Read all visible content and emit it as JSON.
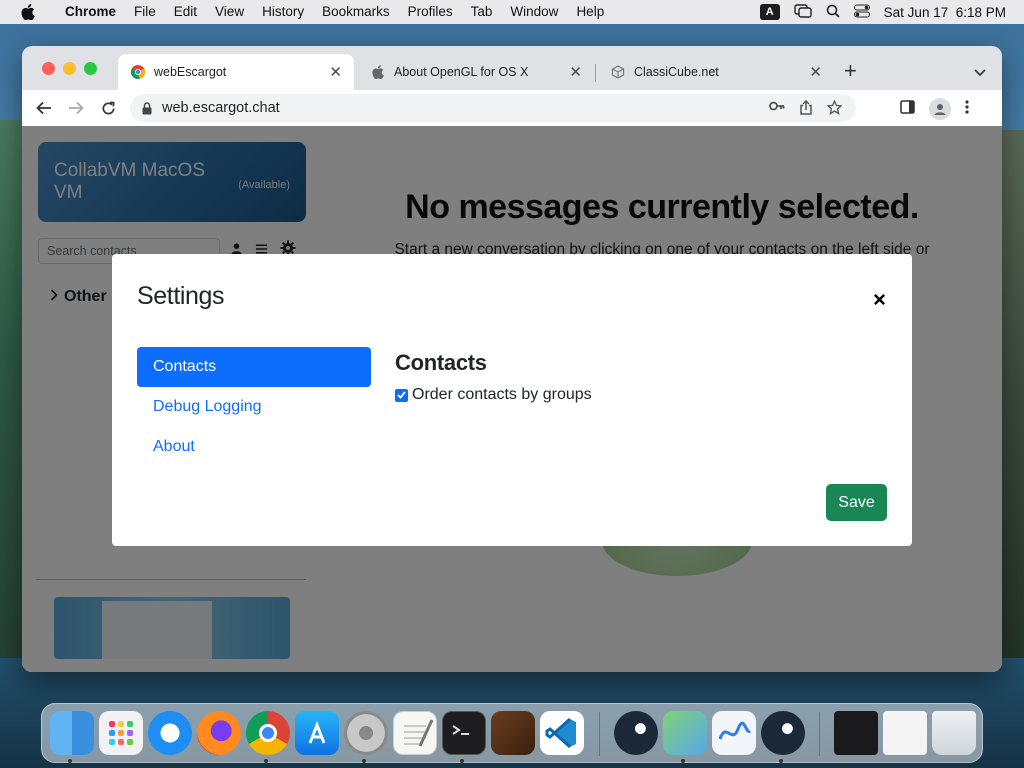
{
  "menubar": {
    "items": [
      "Chrome",
      "File",
      "Edit",
      "View",
      "History",
      "Bookmarks",
      "Profiles",
      "Tab",
      "Window",
      "Help"
    ],
    "input_source": "A",
    "datetime": "Sat Jun 17  6:18 PM"
  },
  "tabs": [
    {
      "title": "webEscargot",
      "active": true,
      "icon": "chrome-favicon"
    },
    {
      "title": "About OpenGL for OS X",
      "active": false,
      "icon": "apple-favicon"
    },
    {
      "title": "ClassiCube.net",
      "active": false,
      "icon": "cube-favicon"
    }
  ],
  "toolbar": {
    "url": "web.escargot.chat"
  },
  "sidebar": {
    "vm_name": "CollabVM MacOS VM",
    "vm_status": "(Available)",
    "search_placeholder": "Search contacts",
    "group_label": "Other"
  },
  "main": {
    "title": "No messages currently selected.",
    "subtitle": "Start a new conversation by clicking on one of your contacts on the left side or"
  },
  "settings": {
    "title": "Settings",
    "close": "×",
    "nav": [
      {
        "label": "Contacts",
        "active": true
      },
      {
        "label": "Debug Logging",
        "active": false
      },
      {
        "label": "About",
        "active": false
      }
    ],
    "pane_title": "Contacts",
    "option_label": "Order contacts by groups",
    "option_checked": true,
    "save_label": "Save"
  },
  "dock": {
    "apps": [
      "finder-icon",
      "launchpad-icon",
      "safari-icon",
      "firefox-icon",
      "chrome-icon",
      "app-store-icon",
      "system-preferences-icon",
      "textedit-icon",
      "terminal-icon",
      "garageband-icon",
      "vscode-icon",
      "steam-icon",
      "maps-icon",
      "freeform-icon",
      "steam-icon",
      "window-thumbnail",
      "document-thumbnail",
      "trash-icon"
    ]
  },
  "colors": {
    "primary": "#0d6efd",
    "success": "#198754",
    "overlay": "rgba(0,0,0,0.5)"
  }
}
